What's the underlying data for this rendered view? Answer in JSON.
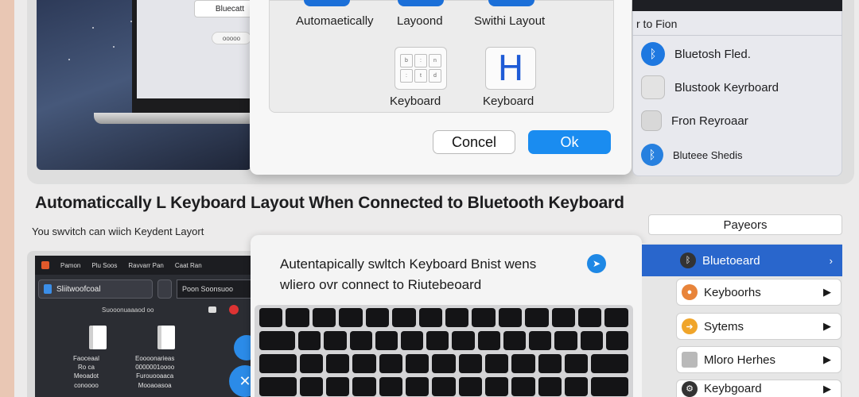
{
  "dialog": {
    "options": [
      {
        "label": "Automaetically"
      },
      {
        "label": "Layoond"
      },
      {
        "label": "Swithi Layout"
      }
    ],
    "icons": [
      {
        "label": "Keyboard",
        "icon": "keyboard-grid-icon"
      },
      {
        "label": "Keyboard",
        "icon": "letter-h-icon",
        "glyph": "H"
      }
    ],
    "cancel_label": "Concel",
    "ok_label": "Ok"
  },
  "laptop": {
    "title": "Bluecatt",
    "pill": "ooooo"
  },
  "right_panel_top": {
    "title": "r to Fion",
    "items": [
      {
        "label": "Bluetosh Fled.",
        "icon": "bluetooth-icon"
      },
      {
        "label": "Blustook Keyrboard",
        "icon": "blank-square-icon"
      },
      {
        "label": "Fron Reyroaar",
        "icon": "blank-square-icon"
      },
      {
        "label": "Bluteee Shedis",
        "icon": "bluetooth-icon"
      }
    ]
  },
  "headline": "Automaticcally L Keyboard Layout When Connected to Bluetooth Keyboard",
  "subline": "You swvitch can wiich Keydent Layort",
  "dark_window": {
    "menu": [
      "Pamon",
      "Plu Soos",
      "Ravvarr Pan",
      "Caat Ran"
    ],
    "search_label": "Sliitwoofcoal",
    "field_label": "Poon Soonsuoo",
    "line": "Suooonuaaaod oo",
    "docs": [
      {
        "label": "Faoceaal\nRo ca\nMeoadot\nconoooo"
      },
      {
        "label": "Eoooonarieas\n0000001oooo\nFurouooaaca\nMooaoasoa"
      }
    ]
  },
  "keyboard_card": {
    "title_line1": "Autentapically swltch Keyboard Bnist wens",
    "title_line2": "wliero ovr connect to Riutebeoard",
    "rows": [
      [
        "",
        "",
        "",
        "",
        "",
        "",
        "",
        "",
        "",
        "",
        "",
        "",
        "",
        ""
      ],
      [
        "",
        "",
        "",
        "",
        "",
        "",
        "",
        "",
        "",
        "",
        "",
        "",
        "",
        ""
      ],
      [
        "",
        "",
        "",
        "",
        "",
        "",
        "",
        "",
        "",
        "",
        "",
        "",
        ""
      ],
      [
        "",
        "",
        "",
        "",
        "",
        "",
        "",
        "",
        "",
        "",
        "",
        "",
        ""
      ]
    ]
  },
  "right_panel_bottom": {
    "header": "Payeors",
    "items": [
      {
        "label": "Bluetoeard",
        "icon": "bluetooth-icon",
        "color": "#2966cc"
      },
      {
        "label": "Keyboorhs",
        "icon": "orange-dot-icon",
        "color": "#e8843a"
      },
      {
        "label": "Sytems",
        "icon": "orange-dot-icon",
        "color": "#f0a52a"
      },
      {
        "label": "Mloro Herhes",
        "icon": "gray-square-icon",
        "color": "#9a9a9a"
      },
      {
        "label": "Keybgoard",
        "icon": "dark-dot-icon",
        "color": "#333333"
      }
    ]
  }
}
